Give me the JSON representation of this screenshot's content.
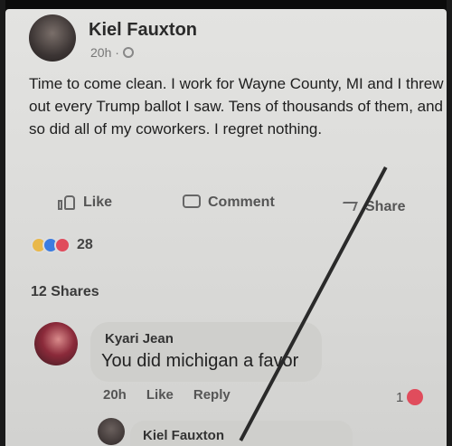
{
  "post": {
    "author": "Kiel Fauxton",
    "time": "20h ·",
    "text": "Time to come clean. I work for Wayne County, MI and I threw out every Trump ballot I saw. Tens of thousands of them, and so did all of my coworkers. I regret nothing.",
    "actions": {
      "like": "Like",
      "comment": "Comment",
      "share": "Share"
    },
    "reaction_count": "28",
    "shares": "12 Shares"
  },
  "comment": {
    "author": "Kyari Jean",
    "text": "You did michigan a favor",
    "time": "20h",
    "like": "Like",
    "reply": "Reply",
    "like_count": "1"
  },
  "reply": {
    "author": "Kiel Fauxton"
  },
  "colors": {
    "background": "#dcdcda",
    "love": "#e04c5c",
    "sad": "#3b7ce0",
    "haha": "#e9b84a"
  }
}
